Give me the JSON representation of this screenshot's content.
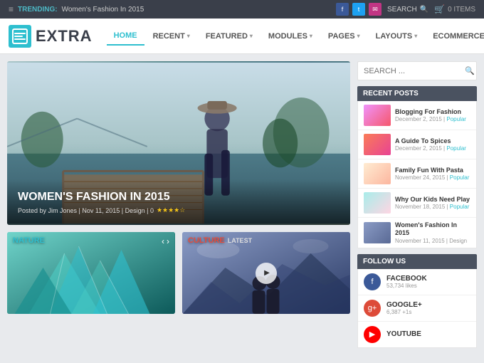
{
  "topbar": {
    "trending_label": "TRENDING:",
    "trending_text": "Women's Fashion In 2015",
    "search_label": "SEARCH",
    "cart_label": "0 ITEMS",
    "social": [
      {
        "name": "facebook",
        "letter": "f"
      },
      {
        "name": "twitter",
        "letter": "t"
      },
      {
        "name": "instagram",
        "letter": "i"
      }
    ]
  },
  "nav": {
    "logo_text": "EXTRA",
    "items": [
      {
        "label": "HOME",
        "active": true,
        "has_dropdown": false
      },
      {
        "label": "RECENT",
        "active": false,
        "has_dropdown": true
      },
      {
        "label": "FEATURED",
        "active": false,
        "has_dropdown": true
      },
      {
        "label": "MODULES",
        "active": false,
        "has_dropdown": true
      },
      {
        "label": "PAGES",
        "active": false,
        "has_dropdown": true
      },
      {
        "label": "LAYOUTS",
        "active": false,
        "has_dropdown": true
      },
      {
        "label": "ECOMMERCE",
        "active": false,
        "has_dropdown": false
      }
    ]
  },
  "hero": {
    "title": "WOMEN'S FASHION IN 2015",
    "meta": "Posted by Jim Jones | Nov 11, 2015 | Design | 0",
    "stars": "★★★★☆"
  },
  "sections": {
    "nature": {
      "label": "NATURE",
      "latest": ""
    },
    "culture": {
      "label": "CULTURE",
      "latest": "Latest"
    }
  },
  "sidebar": {
    "search_placeholder": "SEARCH ...",
    "recent_posts_title": "RECENT POSTS",
    "follow_title": "FOLLOW US",
    "posts": [
      {
        "title": "Blogging For Fashion",
        "date": "December 2, 2015",
        "category": "Popular",
        "thumb": "p1"
      },
      {
        "title": "A Guide To Spices",
        "date": "December 2, 2015",
        "category": "Popular",
        "thumb": "p2"
      },
      {
        "title": "Family Fun With Pasta",
        "date": "November 24, 2015",
        "category": "Popular",
        "thumb": "p3"
      },
      {
        "title": "Why Our Kids Need Play",
        "date": "November 18, 2015",
        "category": "Popular",
        "thumb": "p4"
      },
      {
        "title": "Women's Fashion In 2015",
        "date": "November 11, 2015",
        "category": "Design",
        "thumb": "p5"
      }
    ],
    "follow": [
      {
        "network": "FACEBOOK",
        "count": "53,734 likes",
        "icon": "fb",
        "letter": "f"
      },
      {
        "network": "GOOGLE+",
        "count": "6,387 +1s",
        "icon": "gp",
        "letter": "g"
      },
      {
        "network": "YOUTUBE",
        "count": "",
        "icon": "yt",
        "letter": "▶"
      }
    ]
  }
}
